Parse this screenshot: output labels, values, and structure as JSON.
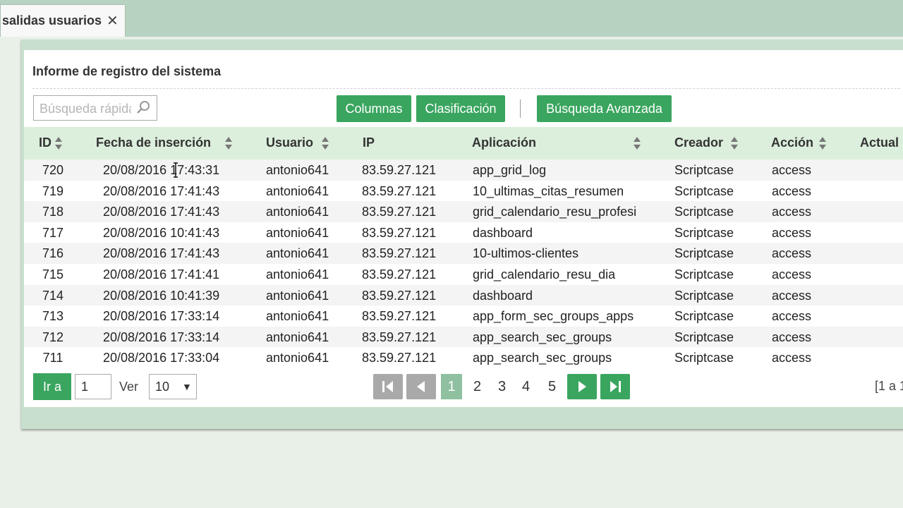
{
  "tab": {
    "title": "salidas usuarios",
    "close": "✕"
  },
  "report": {
    "title": "Informe de registro del sistema",
    "search_placeholder": "Búsqueda rápida",
    "buttons": {
      "columns": "Columnas",
      "sort": "Clasificación",
      "advanced": "Búsqueda Avanzada"
    }
  },
  "table": {
    "headers": [
      "ID",
      "Fecha de inserción",
      "Usuario",
      "IP",
      "Aplicación",
      "Creador",
      "Acción",
      "Actual"
    ],
    "rows": [
      [
        "720",
        "20/08/2016 17:43:31",
        "antonio641",
        "83.59.27.121",
        "app_grid_log",
        "Scriptcase",
        "access"
      ],
      [
        "719",
        "20/08/2016 17:41:43",
        "antonio641",
        "83.59.27.121",
        "10_ultimas_citas_resumen",
        "Scriptcase",
        "access"
      ],
      [
        "718",
        "20/08/2016 17:41:43",
        "antonio641",
        "83.59.27.121",
        "grid_calendario_resu_profesi",
        "Scriptcase",
        "access"
      ],
      [
        "717",
        "20/08/2016 10:41:43",
        "antonio641",
        "83.59.27.121",
        "dashboard",
        "Scriptcase",
        "access"
      ],
      [
        "716",
        "20/08/2016 17:41:43",
        "antonio641",
        "83.59.27.121",
        "10-ultimos-clientes",
        "Scriptcase",
        "access"
      ],
      [
        "715",
        "20/08/2016 17:41:41",
        "antonio641",
        "83.59.27.121",
        "grid_calendario_resu_dia",
        "Scriptcase",
        "access"
      ],
      [
        "714",
        "20/08/2016 10:41:39",
        "antonio641",
        "83.59.27.121",
        "dashboard",
        "Scriptcase",
        "access"
      ],
      [
        "713",
        "20/08/2016 17:33:14",
        "antonio641",
        "83.59.27.121",
        "app_form_sec_groups_apps",
        "Scriptcase",
        "access"
      ],
      [
        "712",
        "20/08/2016 17:33:14",
        "antonio641",
        "83.59.27.121",
        "app_search_sec_groups",
        "Scriptcase",
        "access"
      ],
      [
        "711",
        "20/08/2016 17:33:04",
        "antonio641",
        "83.59.27.121",
        "app_search_sec_groups",
        "Scriptcase",
        "access"
      ]
    ]
  },
  "footer": {
    "goto_label": "Ir a",
    "goto_value": "1",
    "view_label": "Ver",
    "per_page": "10",
    "per_page_arrow": "▼",
    "current_page": "1",
    "pages": [
      "2",
      "3",
      "4",
      "5"
    ],
    "range": "[1 a 1"
  },
  "colors": {
    "accent": "#3aa55f",
    "header_bg": "#dcefdd",
    "topbar": "#b7d2c0"
  }
}
